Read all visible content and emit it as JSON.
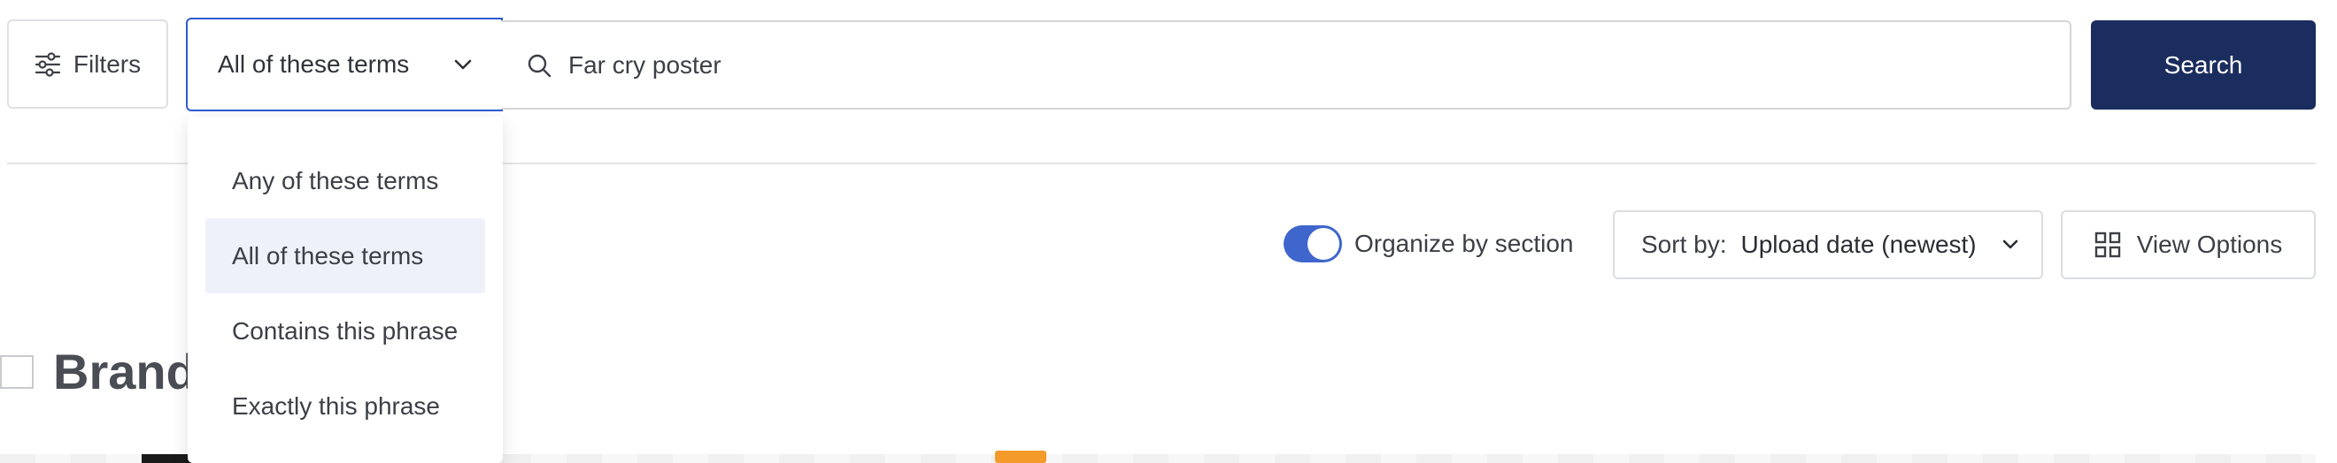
{
  "toolbar": {
    "filters_label": "Filters",
    "mode_selected": "All of these terms",
    "search_value": "Far cry poster",
    "search_button_label": "Search"
  },
  "mode_dropdown": {
    "options": [
      {
        "label": "Any of these terms"
      },
      {
        "label": "All of these terms",
        "selected": true
      },
      {
        "label": "Contains this phrase"
      },
      {
        "label": "Exactly this phrase"
      }
    ]
  },
  "results_toolbar": {
    "organize_label": "Organize by section",
    "organize_on": true,
    "sort_label": "Sort by:",
    "sort_value": "Upload date (newest)",
    "view_options_label": "View Options"
  },
  "section": {
    "title": "Brand"
  },
  "colors": {
    "accent": "#3f66cc",
    "primary_button": "#1b2d5e",
    "select_border": "#2f5bd0",
    "selected_option_bg": "#eef1f9"
  },
  "icons": {
    "filters": "sliders-icon",
    "mode_chevron": "chevron-down-icon",
    "search": "search-icon",
    "sort_chevron": "chevron-down-icon",
    "view_options": "grid-icon"
  }
}
